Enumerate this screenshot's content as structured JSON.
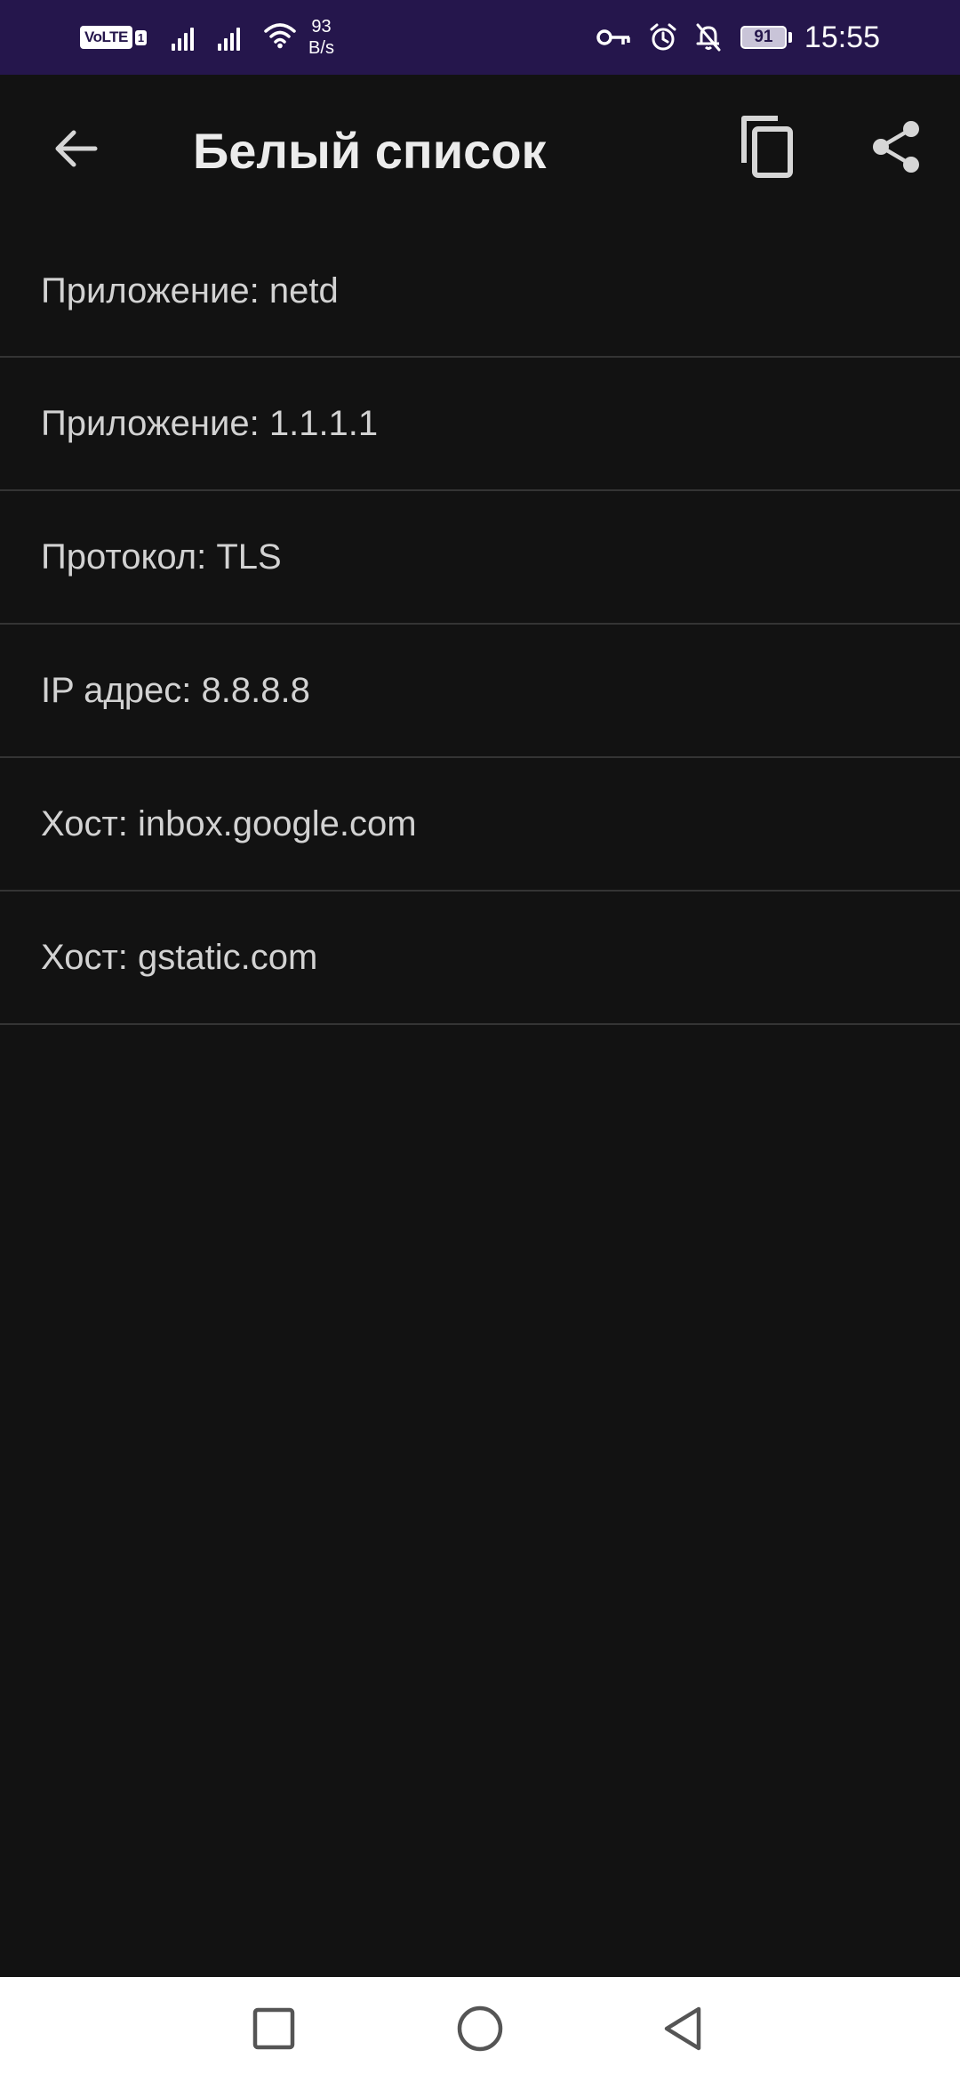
{
  "status_bar": {
    "volte": "VoLTE",
    "sim_slot": "1",
    "net_speed_value": "93",
    "net_speed_unit": "B/s",
    "battery": "91",
    "time": "15:55",
    "icons": [
      "signal-icon",
      "signal-icon",
      "wifi-icon",
      "vpn-key-icon",
      "alarm-icon",
      "notifications-off-icon",
      "battery-icon"
    ]
  },
  "app_bar": {
    "title": "Белый список",
    "icons": [
      "arrow-back-icon",
      "copy-icon",
      "share-icon"
    ]
  },
  "rules": [
    {
      "label": "Приложение: netd"
    },
    {
      "label": "Приложение: 1.1.1.1"
    },
    {
      "label": "Протокол: TLS"
    },
    {
      "label": "IP адрес: 8.8.8.8"
    },
    {
      "label": "Хост: inbox.google.com"
    },
    {
      "label": "Хост: gstatic.com"
    }
  ],
  "nav_bar": {
    "icons": [
      "recent-apps-icon",
      "home-icon",
      "back-triangle-icon"
    ]
  },
  "colors": {
    "status_bar_bg": "#25164c",
    "background": "#121212",
    "text": "#d2d2d2",
    "divider": "#343434",
    "nav_bar_bg": "#ffffff"
  }
}
